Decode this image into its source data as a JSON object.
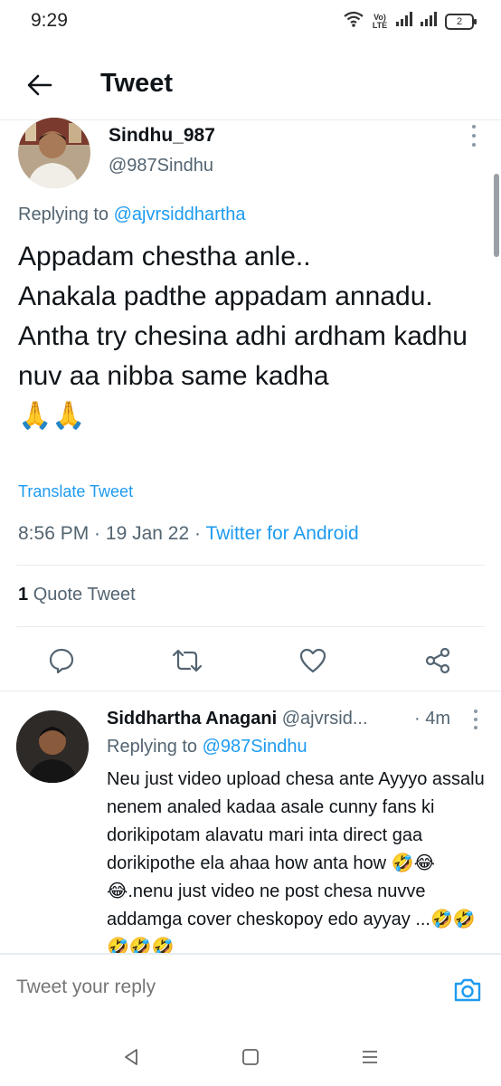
{
  "status_bar": {
    "time": "9:29",
    "volte_line1": "Vo)",
    "volte_line2": "LTE",
    "battery": "2",
    "icons": [
      "wifi-icon",
      "volte-icon",
      "signal-icon",
      "signal-icon",
      "battery-icon"
    ]
  },
  "header": {
    "title": "Tweet",
    "back_icon": "arrow-left-icon"
  },
  "tweet": {
    "display_name": "Sindhu_987",
    "handle": "@987Sindhu",
    "replying_prefix": "Replying to ",
    "replying_to": "@ajvrsiddhartha",
    "text": "Appadam chestha anle..\nAnakala padthe appadam annadu.\nAntha try chesina adhi ardham kadhu nuv aa nibba same kadha\n🙏🙏",
    "translate_label": "Translate Tweet",
    "time": "8:56 PM",
    "date": "19 Jan 22",
    "source": "Twitter for Android",
    "quote_count": "1",
    "quote_label": "Quote Tweet"
  },
  "actions": [
    "reply-icon",
    "retweet-icon",
    "like-icon",
    "share-icon"
  ],
  "reply": {
    "display_name": "Siddhartha Anagani",
    "handle": "@ajvrsid...",
    "time": "· 4m",
    "replying_prefix": "Replying to ",
    "replying_to": "@987Sindhu",
    "text": "Neu just video upload chesa ante Ayyyo assalu nenem analed kadaa asale cunny fans ki dorikipotam alavatu mari inta direct gaa dorikipothe ela  ahaa how anta how  🤣😂😂.nenu just video ne post chesa nuvve addamga cover cheskopoy edo ayyay ...🤣🤣🤣🤣🤣"
  },
  "compose": {
    "placeholder": "Tweet your reply",
    "camera_icon": "camera-icon"
  },
  "navigation": [
    "back-triangle-icon",
    "home-square-icon",
    "menu-lines-icon"
  ],
  "colors": {
    "accent": "#1d9bf0",
    "text_primary": "#0f1419",
    "text_secondary": "#536471",
    "divider": "#e6ecf0"
  }
}
